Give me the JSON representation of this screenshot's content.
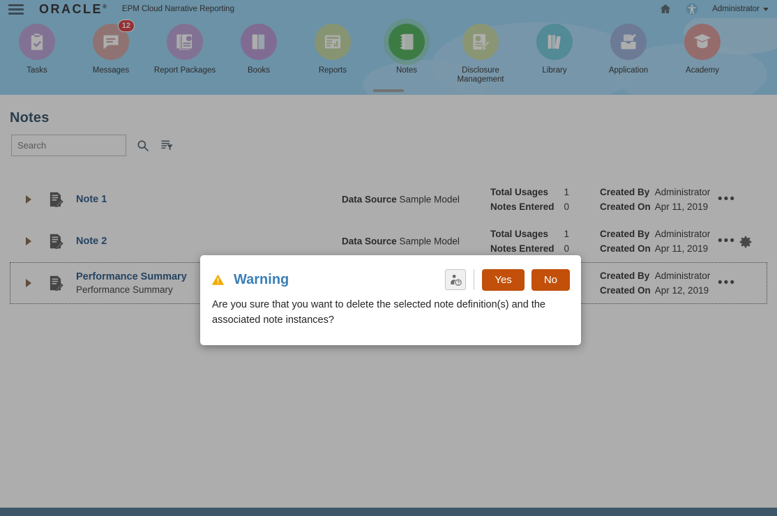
{
  "topbar": {
    "menu_icon": "hamburger-icon",
    "brand": "ORACLE",
    "brand_tm": "®",
    "app_title": "EPM Cloud Narrative Reporting",
    "home_icon": "home-icon",
    "accessibility_icon": "accessibility-icon",
    "user": "Administrator"
  },
  "nav": {
    "items": [
      {
        "label": "Tasks",
        "icon": "clipboard-check-icon",
        "color": "#b49ad2",
        "active": false,
        "badge": null
      },
      {
        "label": "Messages",
        "icon": "speech-bubble-icon",
        "color": "#cb9b9b",
        "active": false,
        "badge": "12"
      },
      {
        "label": "Report Packages",
        "icon": "report-stack-icon",
        "color": "#b49ad2",
        "active": false,
        "badge": null
      },
      {
        "label": "Books",
        "icon": "books-icon",
        "color": "#b18fd0",
        "active": false,
        "badge": null
      },
      {
        "label": "Reports",
        "icon": "report-chart-icon",
        "color": "#bcd49a",
        "active": false,
        "badge": null
      },
      {
        "label": "Notes",
        "icon": "notebook-icon",
        "color": "#3faa4a",
        "active": true,
        "badge": null
      },
      {
        "label": "Disclosure Management",
        "icon": "disclosure-icon",
        "color": "#c3d79b",
        "active": false,
        "badge": null
      },
      {
        "label": "Library",
        "icon": "library-books-icon",
        "color": "#63c3d8",
        "active": false,
        "badge": null
      },
      {
        "label": "Application",
        "icon": "application-box-icon",
        "color": "#8fa8d8",
        "active": false,
        "badge": null
      },
      {
        "label": "Academy",
        "icon": "graduation-cap-icon",
        "color": "#d49090",
        "active": false,
        "badge": null
      }
    ],
    "drag_handle": "panel-drag-handle"
  },
  "page": {
    "title": "Notes",
    "search_placeholder": "Search",
    "search_value": "",
    "search_icon": "magnifier-icon",
    "filter_icon": "filter-list-icon",
    "settings_icon": "gear-icon"
  },
  "labels": {
    "data_source": "Data Source",
    "total_usages": "Total Usages",
    "notes_entered": "Notes Entered",
    "created_by": "Created By",
    "created_on": "Created On",
    "row_menu": "•••"
  },
  "rows": [
    {
      "name": "Note 1",
      "subtitle": "",
      "data_source": "Sample Model",
      "total_usages": "1",
      "notes_entered": "0",
      "created_by": "Administrator",
      "created_on": "Apr 11, 2019",
      "selected": false
    },
    {
      "name": "Note 2",
      "subtitle": "",
      "data_source": "Sample Model",
      "total_usages": "1",
      "notes_entered": "0",
      "created_by": "Administrator",
      "created_on": "Apr 11, 2019",
      "selected": false
    },
    {
      "name": "Performance Summary",
      "subtitle": "Performance Summary",
      "data_source": "",
      "total_usages": "",
      "notes_entered": "",
      "created_by": "Administrator",
      "created_on": "Apr 12, 2019",
      "selected": true
    }
  ],
  "dialog": {
    "warning_icon": "warning-triangle-icon",
    "title": "Warning",
    "help_icon": "user-help-icon",
    "yes_label": "Yes",
    "no_label": "No",
    "message": "Are you sure that you want to delete the selected note definition(s) and the associated note instances?"
  },
  "colors": {
    "sky": "#8fd0f5",
    "accent_blue": "#15497e",
    "button_orange": "#c2500a",
    "badge_red": "#d8282f",
    "title_blue": "#22405a",
    "dialog_title_blue": "#3b7fb6",
    "warning_amber": "#f0ab00",
    "footer": "#3d5668"
  }
}
